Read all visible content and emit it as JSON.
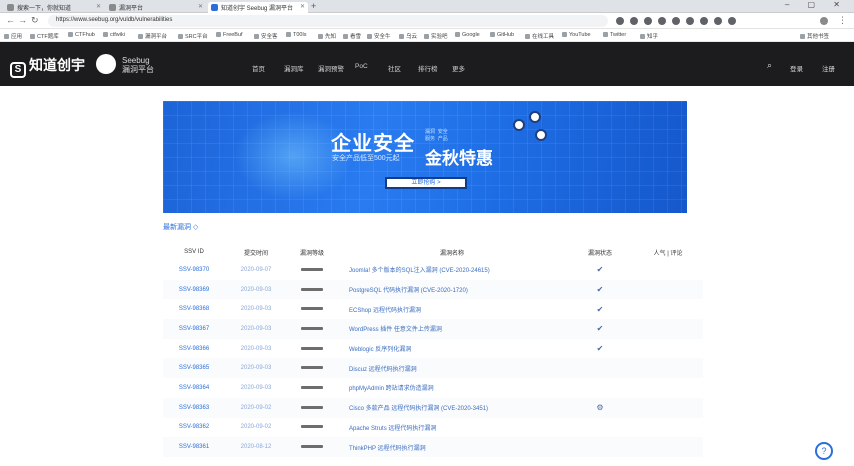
{
  "browser": {
    "tabs": [
      {
        "label": "搜索一下，你就知道"
      },
      {
        "label": "漏洞平台"
      },
      {
        "label": "知道创宇 Seebug 漏洞平台"
      }
    ],
    "new_tab": "+",
    "window_controls": "–  ▢  ✕",
    "url": "https://www.seebug.org/vuldb/vulnerabilities",
    "bookmarks": [
      "应用",
      "CTF题库",
      "CTFhub",
      "ctfwiki",
      "漏洞平台",
      "SRC平台",
      "FreeBuf",
      "安全客",
      "T00ls",
      "先知",
      "看雪",
      "安全牛",
      "乌云",
      "实验吧",
      "Google",
      "GitHub",
      "在线工具",
      "YouTube",
      "Twitter",
      "知乎",
      "其他书签"
    ]
  },
  "site": {
    "logo_text": "知道创宇",
    "logo_letter": "S",
    "brand2_line1": "Seebug",
    "brand2_line2": "漏洞平台",
    "nav": [
      "首页",
      "漏洞库",
      "漏洞预警",
      "PoC",
      "社区",
      "排行榜",
      "更多"
    ],
    "login": "登录",
    "register": "注册"
  },
  "banner": {
    "headline": "企业安全",
    "subline": "安全产品低至500元起",
    "headline2": "金秋特惠",
    "tags": "漏洞  安全\n服务  产品",
    "button": "立即抢购 >"
  },
  "section": {
    "title": "最新漏洞 ◇"
  },
  "table": {
    "headers": [
      "SSV ID",
      "提交时间",
      "漏洞等级",
      "漏洞名称",
      "漏洞状态",
      "人气 | 评论"
    ],
    "rows": [
      {
        "id": "SSV-98370",
        "date": "2020-09-07",
        "name": "Joomla! 多个版本的SQL注入漏洞 (CVE-2020-24615)",
        "status": "✔"
      },
      {
        "id": "SSV-98369",
        "date": "2020-09-03",
        "name": "PostgreSQL 代码执行漏洞 (CVE-2020-1720)",
        "status": "✔"
      },
      {
        "id": "SSV-98368",
        "date": "2020-09-03",
        "name": "ECShop 远程代码执行漏洞",
        "status": "✔"
      },
      {
        "id": "SSV-98367",
        "date": "2020-09-03",
        "name": "WordPress 插件 任意文件上传漏洞",
        "status": "✔"
      },
      {
        "id": "SSV-98366",
        "date": "2020-09-03",
        "name": "Weblogic 反序列化漏洞",
        "status": "✔"
      },
      {
        "id": "SSV-98365",
        "date": "2020-09-03",
        "name": "Discuz 远程代码执行漏洞",
        "status": ""
      },
      {
        "id": "SSV-98364",
        "date": "2020-09-03",
        "name": "phpMyAdmin 跨站请求伪造漏洞",
        "status": ""
      },
      {
        "id": "SSV-98363",
        "date": "2020-09-02",
        "name": "Cisco 多款产品 远程代码执行漏洞 (CVE-2020-3451)",
        "status": "⚙"
      },
      {
        "id": "SSV-98362",
        "date": "2020-09-02",
        "name": "Apache Struts 远程代码执行漏洞",
        "status": ""
      },
      {
        "id": "SSV-98361",
        "date": "2020-08-12",
        "name": "ThinkPHP 远程代码执行漏洞",
        "status": ""
      }
    ]
  },
  "help_icon": "?"
}
